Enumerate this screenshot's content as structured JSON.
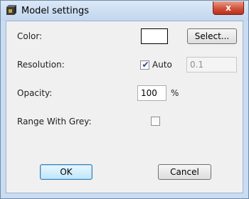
{
  "window": {
    "title": "Model settings",
    "close_glyph": "x"
  },
  "form": {
    "color_label": "Color:",
    "color_value": "#ffffff",
    "select_button": "Select...",
    "resolution_label": "Resolution:",
    "auto_label": "Auto",
    "auto_checked": true,
    "resolution_value": "0.1",
    "opacity_label": "Opacity:",
    "opacity_value": "100",
    "opacity_unit": "%",
    "range_grey_label": "Range With Grey:",
    "range_grey_checked": false
  },
  "buttons": {
    "ok": "OK",
    "cancel": "Cancel"
  },
  "icons": {
    "app": "app-cube-icon",
    "close": "close-icon",
    "check": "checkmark-icon"
  }
}
